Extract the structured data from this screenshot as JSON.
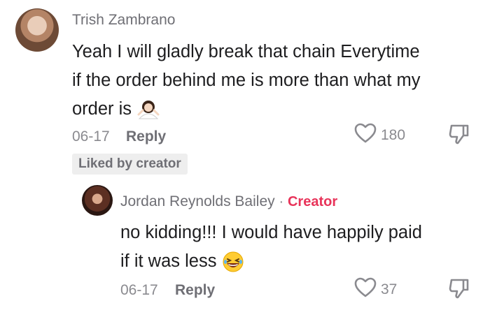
{
  "comment": {
    "author": "Trish Zambrano",
    "text_line1": "Yeah I will gladly break that chain Everytime",
    "text_line2": "if the order behind me is more than what my",
    "text_line3": "order is",
    "date": "06-17",
    "reply_label": "Reply",
    "like_count": "180",
    "badge": "Liked by creator"
  },
  "reply": {
    "author": "Jordan Reynolds Bailey",
    "separator": "·",
    "creator_label": "Creator",
    "text_line1": "no kidding!!! I would have happily paid",
    "text_line2": "if it was less",
    "date": "06-17",
    "reply_label": "Reply",
    "like_count": "37"
  },
  "icons": {
    "heart": "heart-outline-icon",
    "dislike": "thumbs-down-icon",
    "shrug_emoji": "woman-shrugging-emoji",
    "laugh_emoji": "grinning-squinting-emoji"
  },
  "colors": {
    "accent": "#e8345a",
    "muted": "#8a8a8f",
    "text": "#1d1d1f"
  }
}
